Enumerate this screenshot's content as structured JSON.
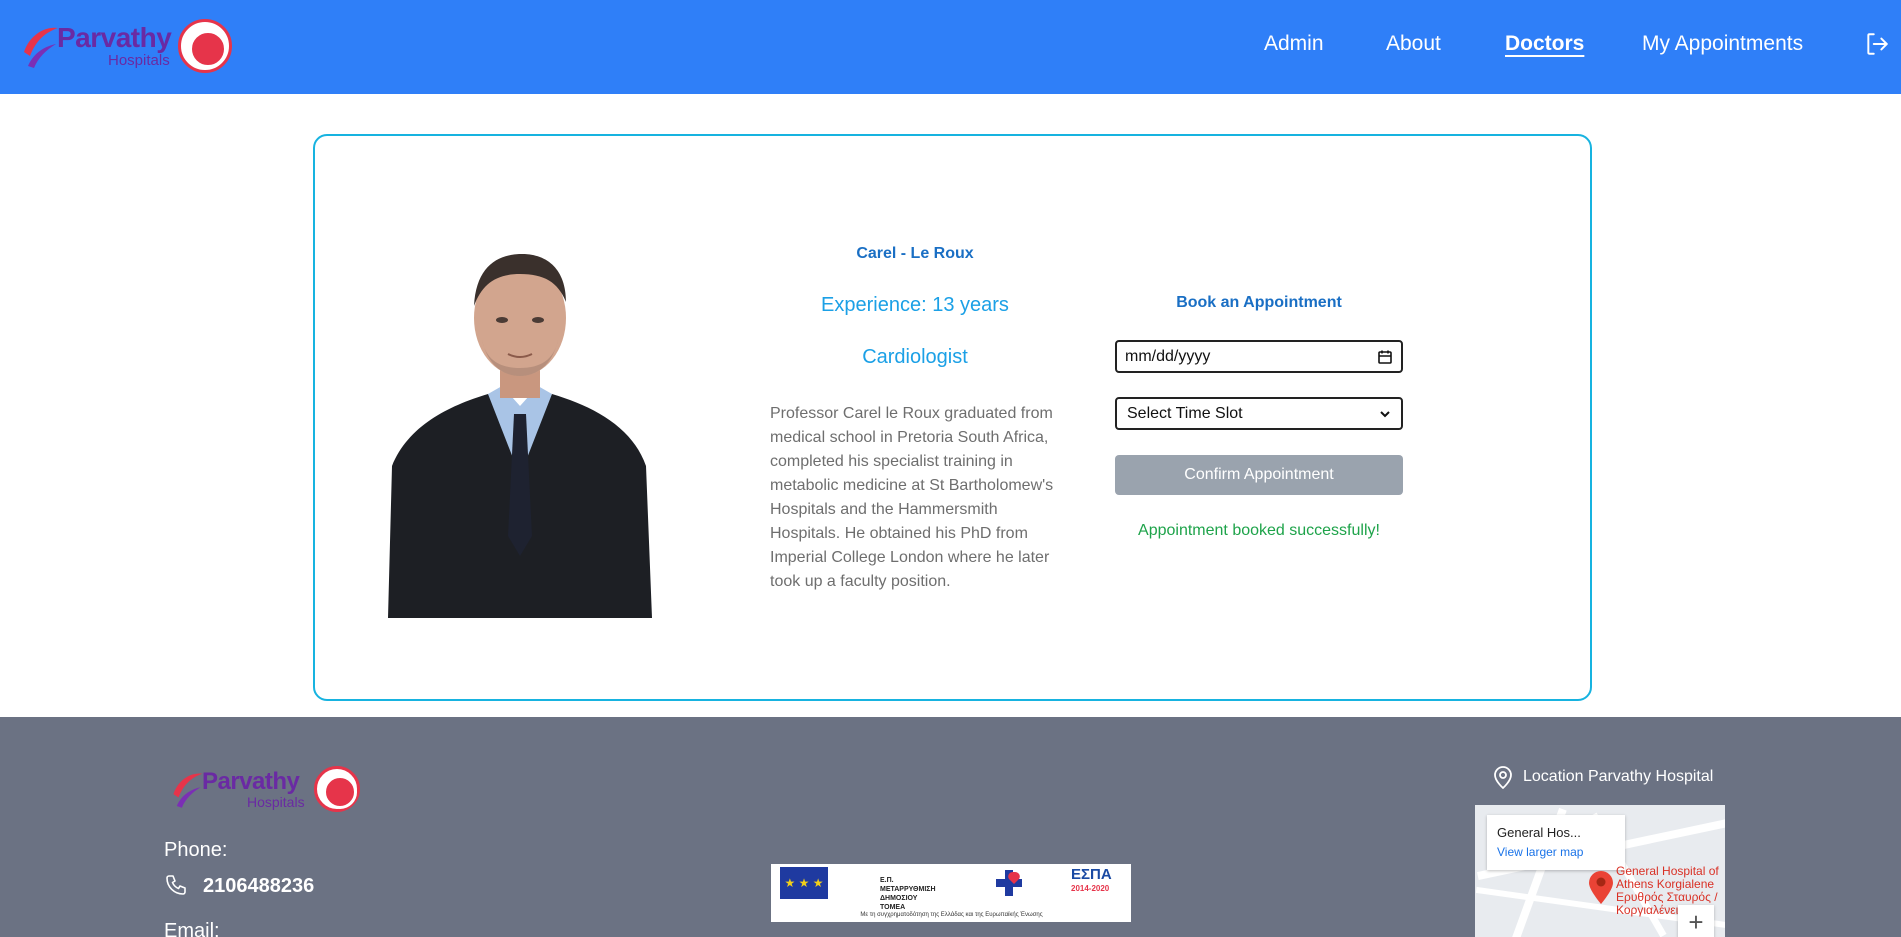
{
  "brand": {
    "name": "Parvathy",
    "subtitle": "Hospitals",
    "colors": {
      "header": "#2f7ff8",
      "accent": "#17b3e0",
      "footer": "#6b7283",
      "success": "#1ea34a"
    }
  },
  "nav": {
    "items": [
      {
        "label": "Admin",
        "active": false
      },
      {
        "label": "About",
        "active": false
      },
      {
        "label": "Doctors",
        "active": true
      },
      {
        "label": "My Appointments",
        "active": false
      }
    ],
    "logout_icon": "logout-icon"
  },
  "doctor": {
    "name": "Carel - Le Roux",
    "experience": "Experience: 13 years",
    "specialty": "Cardiologist",
    "bio": "Professor Carel le Roux graduated from medical school in Pretoria South Africa, completed his specialist training in metabolic medicine at St Bartholomew's Hospitals and the Hammersmith Hospitals. He obtained his PhD from Imperial College London where he later took up a faculty position."
  },
  "booking": {
    "title": "Book an Appointment",
    "date_placeholder": "mm/dd/yyyy",
    "time_slot": "Select Time Slot",
    "confirm_label": "Confirm Appointment",
    "status": "Appointment booked successfully!"
  },
  "footer": {
    "phone_label": "Phone:",
    "phone_number": "2106488236",
    "email_label": "Email:",
    "location_label": "Location Parvathy Hospital",
    "banner": {
      "program_text": "Ε.Π.\nΜΕΤΑΡΡΥΘΜΙΣΗ\nΔΗΜΟΣΙΟΥ\nΤΟΜΕΑ",
      "espa": "ΕΣΠΑ",
      "espa_years": "2014-2020",
      "caption": "Με τη συγχρηματοδότηση της Ελλάδας και της Ευρωπαϊκής Ένωσης"
    },
    "map": {
      "card_title": "General Hos...",
      "larger_map_link": "View larger map",
      "place_line1": "General Hospital of",
      "place_line2": "Athens Korgialene",
      "place_line3": "Ερυθρός Σταυρός /",
      "place_line4": "Κοργιαλένειο",
      "zoom_in": "+"
    }
  }
}
